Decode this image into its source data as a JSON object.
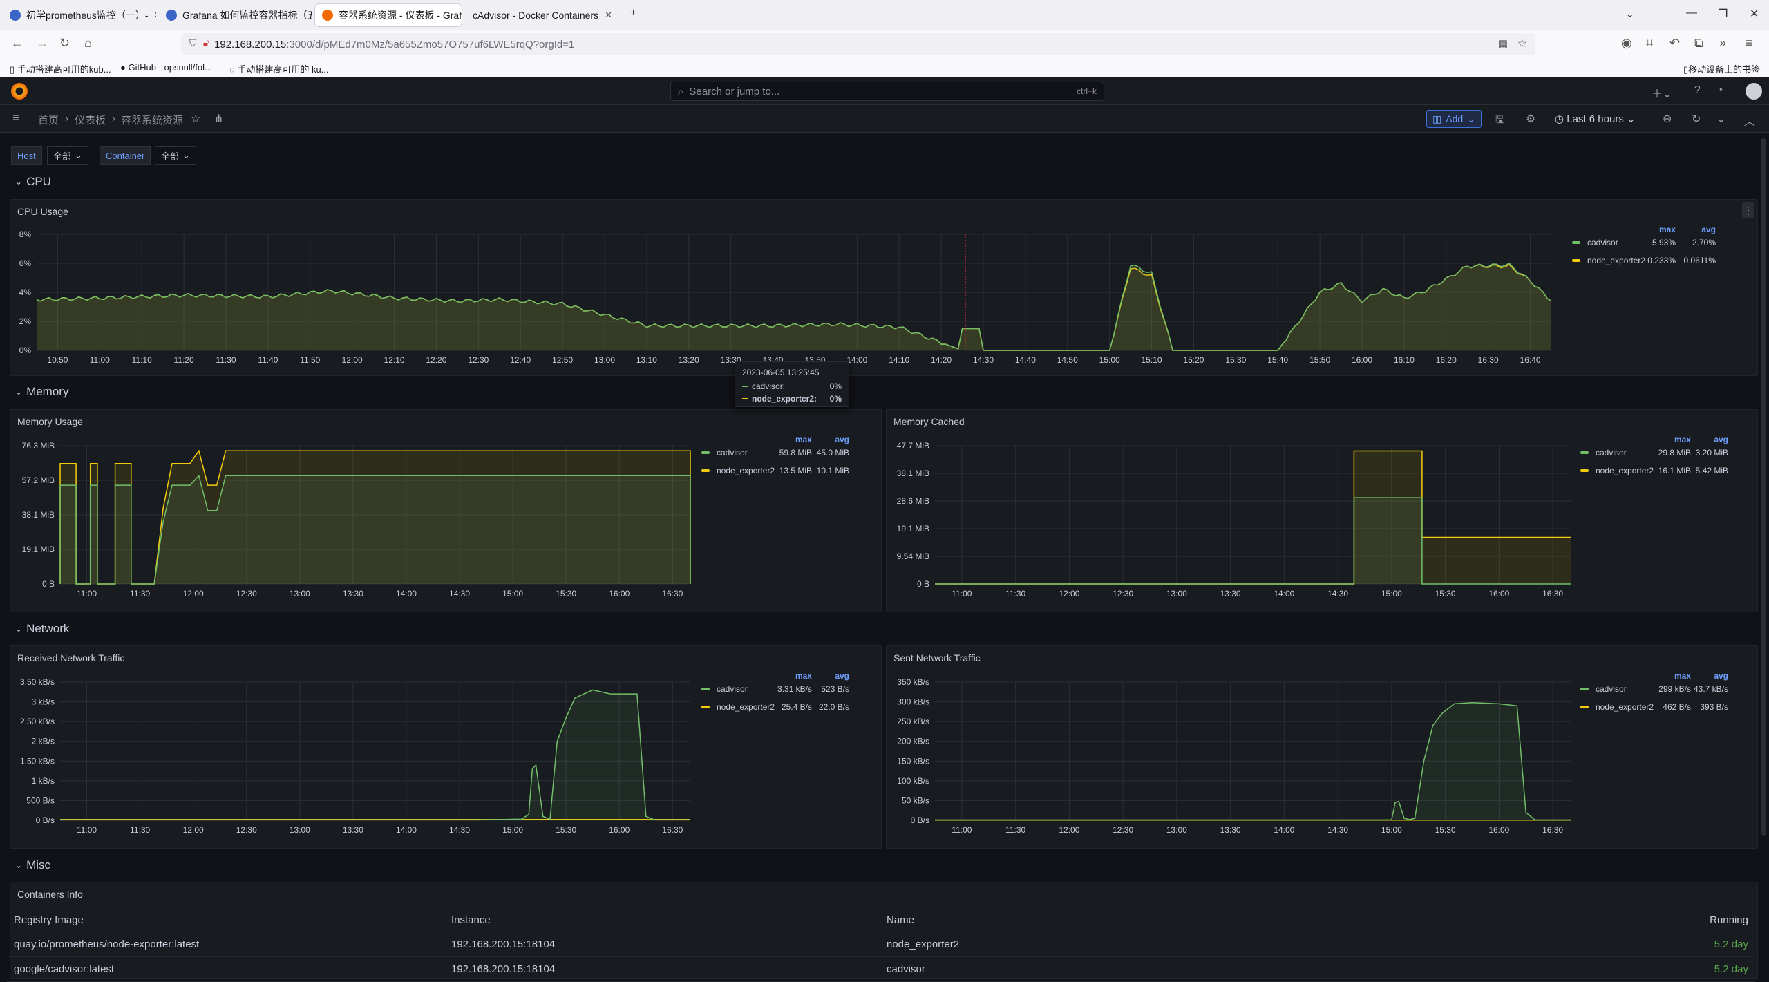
{
  "browser": {
    "tabs": [
      {
        "title": "初学prometheus监控（一）- ",
        "active": false,
        "favicon": "globe-icon"
      },
      {
        "title": "Grafana 如何监控容器指标（五",
        "active": false,
        "favicon": "globe-icon"
      },
      {
        "title": "容器系统资源 - 仪表板 - Grafa",
        "active": true,
        "favicon": "grafana-icon"
      },
      {
        "title": "cAdvisor - Docker Containers",
        "active": false,
        "favicon": ""
      }
    ],
    "url_host": "192.168.200.15",
    "url_rest": ":3000/d/pMEd7m0Mz/5a655Zmo57O757uf6LWE5rqQ?orgId=1",
    "bookmarks": [
      "手动搭建高可用的kub...",
      "GitHub - opsnull/fol...",
      "手动搭建高可用的 ku..."
    ],
    "mobile_bookmarks": "移动设备上的书签"
  },
  "grafana": {
    "search_placeholder": "Search or jump to...",
    "search_shortcut": "ctrl+k",
    "breadcrumb": [
      "首页",
      "仪表板",
      "容器系统资源"
    ],
    "add_label": "Add",
    "time_range": "Last 6 hours",
    "variables": [
      {
        "label": "Host",
        "value": "全部"
      },
      {
        "label": "Container",
        "value": "全部"
      }
    ],
    "rows": [
      "CPU",
      "Memory",
      "Network",
      "Misc"
    ]
  },
  "legend_headers": {
    "max": "max",
    "avg": "avg"
  },
  "tooltip": {
    "time": "2023-06-05 13:25:45",
    "items": [
      {
        "name": "cadvisor:",
        "value": "0%"
      },
      {
        "name": "node_exporter2:",
        "value": "0%"
      }
    ]
  },
  "colors": {
    "cadvisor": "#73bf69",
    "node_exporter2": "#f2cc0c",
    "accent": "#6e9fff"
  },
  "chart_data": [
    {
      "id": "cpu",
      "type": "area",
      "title": "CPU Usage",
      "x_ticks": [
        "10:50",
        "11:00",
        "11:10",
        "11:20",
        "11:30",
        "11:40",
        "11:50",
        "12:00",
        "12:10",
        "12:20",
        "12:30",
        "12:40",
        "12:50",
        "13:00",
        "13:10",
        "13:20",
        "13:30",
        "13:40",
        "13:50",
        "14:00",
        "14:10",
        "14:20",
        "14:30",
        "14:40",
        "14:50",
        "15:00",
        "15:10",
        "15:20",
        "15:30",
        "15:40",
        "15:50",
        "16:00",
        "16:10",
        "16:20",
        "16:30",
        "16:40"
      ],
      "y_ticks": [
        "0%",
        "2%",
        "4%",
        "6%",
        "8%"
      ],
      "ylim": [
        0,
        8
      ],
      "xlim_min": [
        645,
        1005
      ],
      "x_min": [
        645,
        660,
        680,
        700,
        715,
        730,
        745,
        755,
        770,
        790,
        805,
        820,
        835,
        850,
        865,
        880,
        895,
        900,
        905,
        910,
        915,
        920,
        925,
        940,
        950,
        955,
        960,
        965,
        970,
        975,
        980,
        985,
        995,
        1000,
        1005
      ],
      "series": [
        {
          "name": "cadvisor",
          "max": "5.93%",
          "avg": "2.70%",
          "values": [
            3.5,
            3.6,
            3.8,
            3.7,
            4.1,
            3.6,
            3.4,
            3.5,
            3.2,
            1.7,
            1.7,
            1.7,
            1.8,
            1.6,
            0,
            0,
            0,
            0,
            5.9,
            5.3,
            0,
            0,
            0,
            0,
            4.0,
            4.6,
            3.4,
            4.2,
            3.6,
            4.1,
            4.9,
            5.8,
            5.9,
            4.8,
            3.4
          ]
        },
        {
          "name": "node_exporter2",
          "max": "0.233%",
          "avg": "0.0611%",
          "values": [
            3.5,
            3.6,
            3.8,
            3.7,
            4.1,
            3.6,
            3.4,
            3.5,
            3.2,
            1.7,
            1.7,
            1.7,
            1.8,
            1.6,
            0,
            0,
            0,
            0,
            5.7,
            5.1,
            0,
            0,
            0,
            0,
            4.0,
            4.6,
            3.4,
            4.2,
            3.6,
            4.1,
            4.9,
            5.8,
            5.8,
            4.8,
            3.4
          ]
        }
      ],
      "spike_x_min": [
        865,
        869
      ],
      "spike_value": 1.5,
      "marker_x_min": 865.75
    },
    {
      "id": "mem_usage",
      "type": "area",
      "title": "Memory Usage",
      "x_ticks": [
        "11:00",
        "11:30",
        "12:00",
        "12:30",
        "13:00",
        "13:30",
        "14:00",
        "14:30",
        "15:00",
        "15:30",
        "16:00",
        "16:30"
      ],
      "y_ticks": [
        "0 B",
        "19.1 MiB",
        "38.1 MiB",
        "57.2 MiB",
        "76.3 MiB"
      ],
      "ylim": [
        0,
        76.3
      ],
      "xlim_min": [
        645,
        1000
      ],
      "segments": [
        [
          645,
          654
        ],
        [
          662,
          666
        ],
        [
          676,
          685
        ],
        [
          698,
          1000
        ]
      ],
      "series": [
        {
          "name": "cadvisor",
          "max": "59.8 MiB",
          "avg": "45.0 MiB",
          "level": 54.5,
          "late_level": 59.8
        },
        {
          "name": "node_exporter2",
          "max": "13.5 MiB",
          "avg": "10.1 MiB",
          "level": 66.5,
          "late_level": 73.5
        }
      ]
    },
    {
      "id": "mem_cached",
      "type": "area",
      "title": "Memory Cached",
      "x_ticks": [
        "11:00",
        "11:30",
        "12:00",
        "12:30",
        "13:00",
        "13:30",
        "14:00",
        "14:30",
        "15:00",
        "15:30",
        "16:00",
        "16:30"
      ],
      "y_ticks": [
        "0 B",
        "9.54 MiB",
        "19.1 MiB",
        "28.6 MiB",
        "38.1 MiB",
        "47.7 MiB"
      ],
      "ylim": [
        0,
        47.7
      ],
      "xlim_min": [
        645,
        1000
      ],
      "series": [
        {
          "name": "cadvisor",
          "max": "29.8 MiB",
          "avg": "3.20 MiB",
          "x": [
            645,
            879,
            879,
            917,
            917,
            1000
          ],
          "values": [
            0,
            0,
            29.8,
            29.8,
            0,
            0
          ]
        },
        {
          "name": "node_exporter2",
          "max": "16.1 MiB",
          "avg": "5.42 MiB",
          "x": [
            645,
            879,
            879,
            917,
            917,
            1000
          ],
          "values": [
            0,
            0,
            45.9,
            45.9,
            16.1,
            16.1
          ]
        }
      ]
    },
    {
      "id": "net_rx",
      "type": "area",
      "title": "Received Network Traffic",
      "x_ticks": [
        "11:00",
        "11:30",
        "12:00",
        "12:30",
        "13:00",
        "13:30",
        "14:00",
        "14:30",
        "15:00",
        "15:30",
        "16:00",
        "16:30"
      ],
      "y_ticks": [
        "0 B/s",
        "500 B/s",
        "1 kB/s",
        "1.50 kB/s",
        "2 kB/s",
        "2.50 kB/s",
        "3 kB/s",
        "3.50 kB/s"
      ],
      "ylim": [
        0,
        3500
      ],
      "xlim_min": [
        645,
        1000
      ],
      "series": [
        {
          "name": "cadvisor",
          "max": "3.31 kB/s",
          "avg": "523 B/s",
          "x": [
            645,
            880,
            905,
            909,
            911,
            913,
            917,
            921,
            925,
            930,
            935,
            945,
            955,
            970,
            975,
            980,
            985,
            1000
          ],
          "values": [
            10,
            10,
            30,
            150,
            1300,
            1400,
            100,
            30,
            2000,
            2600,
            3100,
            3300,
            3200,
            3200,
            100,
            10,
            10,
            10
          ]
        },
        {
          "name": "node_exporter2",
          "max": "25.4 B/s",
          "avg": "22.0 B/s",
          "x": [
            645,
            1000
          ],
          "values": [
            22,
            22
          ]
        }
      ]
    },
    {
      "id": "net_tx",
      "type": "area",
      "title": "Sent Network Traffic",
      "x_ticks": [
        "11:00",
        "11:30",
        "12:00",
        "12:30",
        "13:00",
        "13:30",
        "14:00",
        "14:30",
        "15:00",
        "15:30",
        "16:00",
        "16:30"
      ],
      "y_ticks": [
        "0 B/s",
        "50 kB/s",
        "100 kB/s",
        "150 kB/s",
        "200 kB/s",
        "250 kB/s",
        "300 kB/s",
        "350 kB/s"
      ],
      "ylim": [
        0,
        350
      ],
      "xlim_min": [
        645,
        1000
      ],
      "series": [
        {
          "name": "cadvisor",
          "max": "299 kB/s",
          "avg": "43.7 kB/s",
          "x": [
            645,
            900,
            902,
            904,
            907,
            910,
            913,
            918,
            923,
            928,
            935,
            945,
            960,
            970,
            975,
            980,
            1000
          ],
          "values": [
            1,
            1,
            45,
            48,
            5,
            2,
            5,
            150,
            240,
            270,
            295,
            298,
            295,
            290,
            20,
            1,
            1
          ]
        },
        {
          "name": "node_exporter2",
          "max": "462 B/s",
          "avg": "393 B/s",
          "x": [
            645,
            1000
          ],
          "values": [
            0.4,
            0.4
          ]
        }
      ]
    }
  ],
  "containers_info": {
    "title": "Containers Info",
    "columns": [
      "Registry Image",
      "Instance",
      "Name",
      "Running"
    ],
    "rows": [
      [
        "quay.io/prometheus/node-exporter:latest",
        "192.168.200.15:18104",
        "node_exporter2",
        "5.2 day"
      ],
      [
        "google/cadvisor:latest",
        "192.168.200.15:18104",
        "cadvisor",
        "5.2 day"
      ]
    ]
  }
}
